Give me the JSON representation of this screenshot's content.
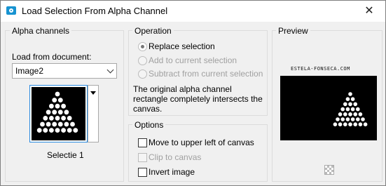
{
  "window": {
    "title": "Load Selection From Alpha Channel",
    "close_glyph": "✕",
    "icon": "camera-icon"
  },
  "alpha_channels": {
    "heading": "Alpha channels",
    "load_from_label": "Load from document:",
    "document_value": "Image2",
    "selection_name": "Selectie 1"
  },
  "operation": {
    "heading": "Operation",
    "options": [
      {
        "label": "Replace selection",
        "checked": true,
        "enabled": true
      },
      {
        "label": "Add to current selection",
        "checked": false,
        "enabled": false
      },
      {
        "label": "Subtract from current selection",
        "checked": false,
        "enabled": false
      }
    ],
    "note": "The original alpha channel rectangle completely intersects the canvas."
  },
  "options": {
    "heading": "Options",
    "items": [
      {
        "label": "Move to upper left of canvas",
        "checked": false,
        "enabled": true
      },
      {
        "label": "Clip to canvas",
        "checked": false,
        "enabled": false
      },
      {
        "label": "Invert image",
        "checked": false,
        "enabled": true
      }
    ]
  },
  "preview": {
    "heading": "Preview",
    "watermark": "ESTELA-FONSECA.COM",
    "background_color": "#000000",
    "shape_color": "#ffffff"
  },
  "colors": {
    "accent": "#2a8ae0",
    "app_icon": "#1793d1"
  }
}
